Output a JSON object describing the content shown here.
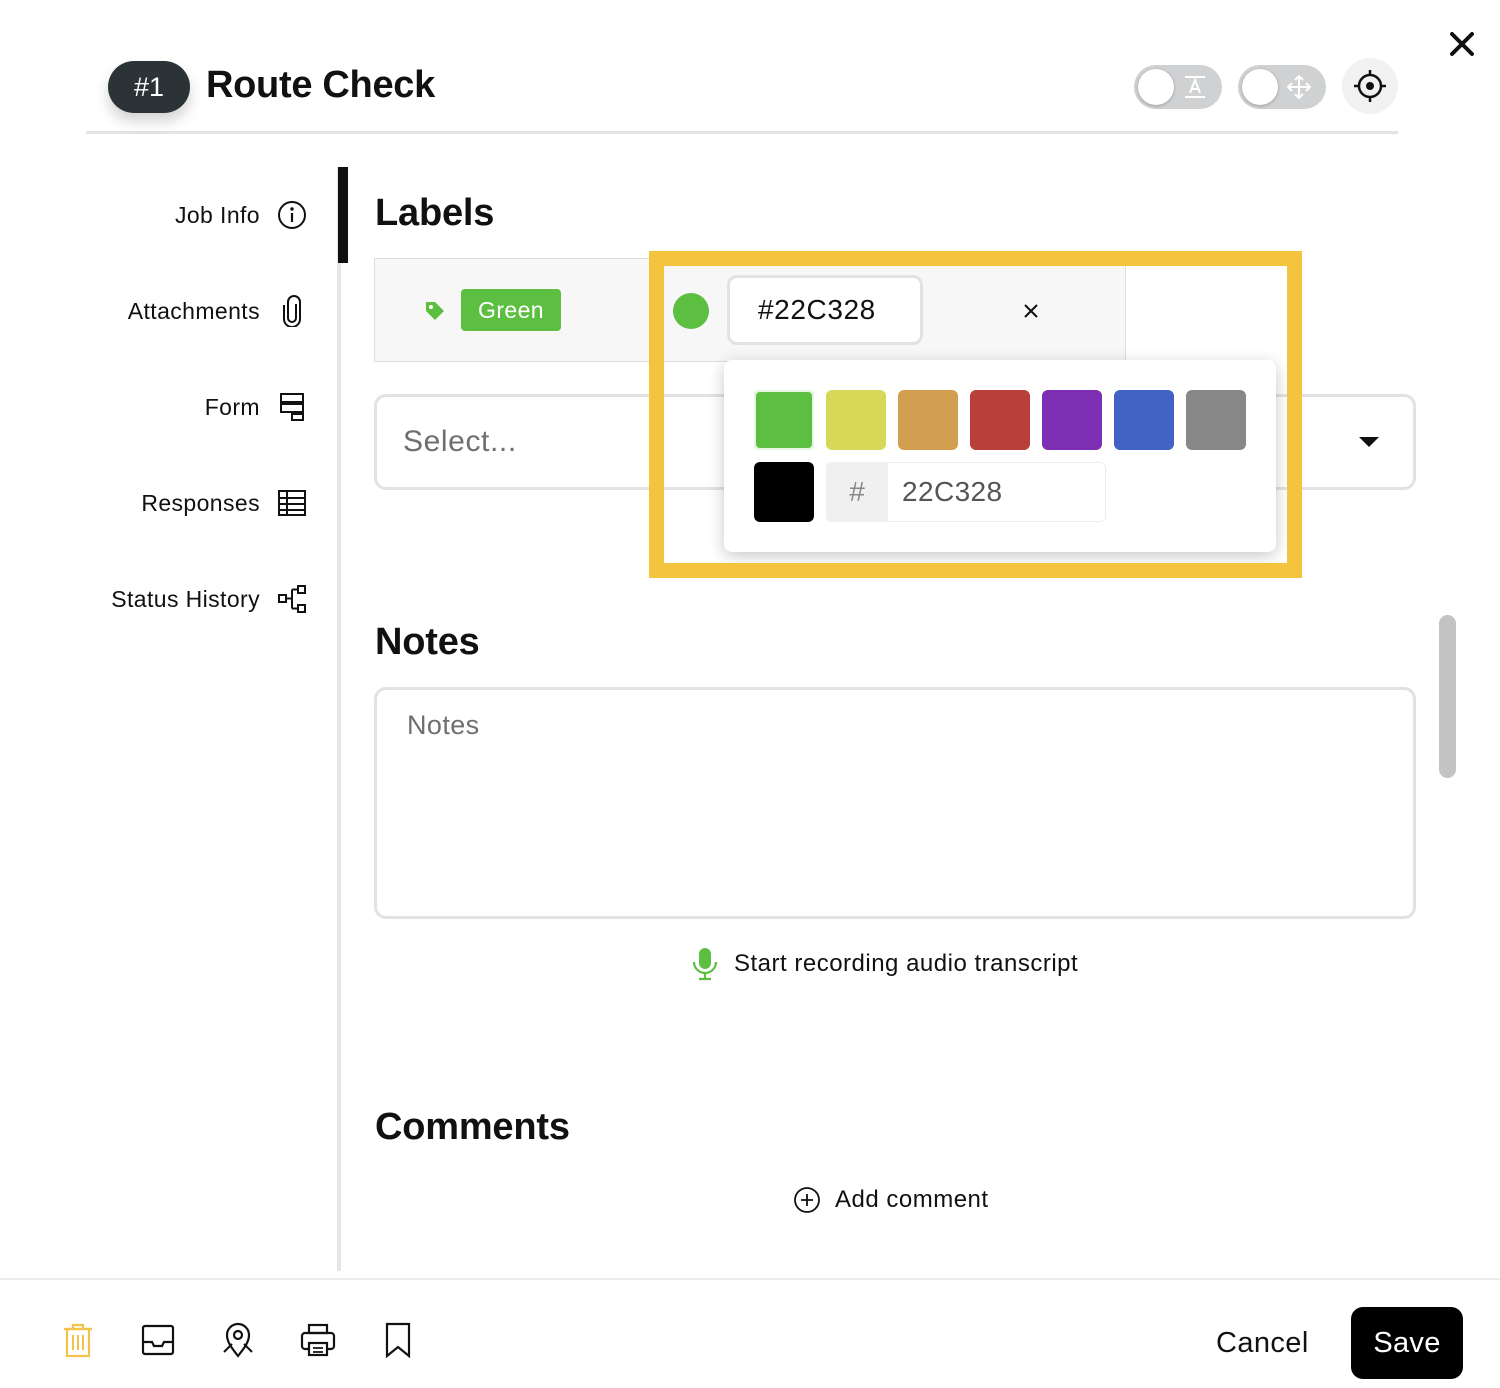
{
  "header": {
    "job_number": "#1",
    "title": "Route Check",
    "toggles": [
      {
        "name": "text-toggle",
        "icon": "text-label-icon",
        "on": false
      },
      {
        "name": "move-toggle",
        "icon": "move-arrows-icon",
        "on": false
      }
    ],
    "target_icon": "crosshair-target-icon",
    "close_icon": "close-icon"
  },
  "sidebar": {
    "items": [
      {
        "label": "Job Info",
        "icon": "info-icon",
        "active": true
      },
      {
        "label": "Attachments",
        "icon": "paperclip-icon"
      },
      {
        "label": "Form",
        "icon": "form-icon"
      },
      {
        "label": "Responses",
        "icon": "table-icon"
      },
      {
        "label": "Status History",
        "icon": "status-history-icon"
      }
    ]
  },
  "labels": {
    "title": "Labels",
    "label_name": "Green",
    "label_color": "#5cbf41",
    "hex_value": "#22C328",
    "select_placeholder": "Select..."
  },
  "color_picker": {
    "swatches": [
      "#5cbf41",
      "#d8d858",
      "#d29e4f",
      "#b93f3a",
      "#7d2fb4",
      "#4164c4",
      "#888888",
      "#000000"
    ],
    "hash": "#",
    "hex_input": "22C328"
  },
  "notes": {
    "title": "Notes",
    "placeholder": "Notes",
    "record_label": "Start recording audio transcript",
    "mic_color": "#5cbf41"
  },
  "comments": {
    "title": "Comments",
    "add_label": "Add comment"
  },
  "footer": {
    "icons": [
      "trash-icon",
      "inbox-icon",
      "map-pin-icon",
      "printer-icon",
      "bookmark-icon"
    ],
    "trash_color": "#f2c24a",
    "cancel_label": "Cancel",
    "save_label": "Save"
  },
  "highlight_color": "#f4c43e"
}
